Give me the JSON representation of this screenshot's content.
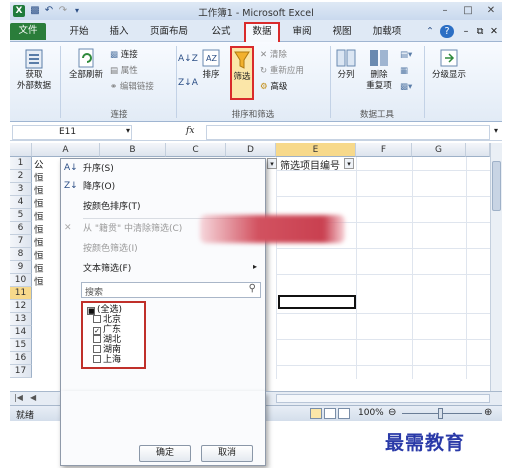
{
  "window": {
    "title": "工作簿1 - Microsoft Excel",
    "qa_icons": [
      "excel-icon",
      "save-icon",
      "undo-icon",
      "redo-icon"
    ]
  },
  "tabs": [
    {
      "label": "文件",
      "name": "tab-file"
    },
    {
      "label": "开始",
      "name": "tab-home"
    },
    {
      "label": "插入",
      "name": "tab-insert"
    },
    {
      "label": "页面布局",
      "name": "tab-page-layout"
    },
    {
      "label": "公式",
      "name": "tab-formulas"
    },
    {
      "label": "数据",
      "name": "tab-data"
    },
    {
      "label": "审阅",
      "name": "tab-review"
    },
    {
      "label": "视图",
      "name": "tab-view"
    },
    {
      "label": "加载项",
      "name": "tab-addins"
    }
  ],
  "ribbon": {
    "get_external_1": "获取",
    "get_external_2": "外部数据",
    "refresh_all": "全部刷新",
    "connections": "连接",
    "properties": "属性",
    "edit_links": "编辑链接",
    "group_connections": "连接",
    "sort": "排序",
    "filter": "筛选",
    "clear": "清除",
    "reapply": "重新应用",
    "advanced": "高级",
    "group_sort_filter": "排序和筛选",
    "text_to_columns": "分列",
    "remove_dup_1": "删除",
    "remove_dup_2": "重复项",
    "group_data_tools": "数据工具",
    "outline": "分级显示"
  },
  "formula_bar": {
    "name_box": "E11",
    "fx": "fx",
    "value": ""
  },
  "columns": [
    "A",
    "B",
    "C",
    "D",
    "E",
    "F",
    "G"
  ],
  "rows": [
    "1",
    "2",
    "3",
    "4",
    "5",
    "6",
    "7",
    "8",
    "9",
    "10",
    "11",
    "12",
    "13",
    "14",
    "15",
    "16",
    "17"
  ],
  "cells": {
    "A1": "公",
    "A2": "恒",
    "A3": "恒",
    "A4": "恒",
    "A5": "恒",
    "A6": "恒",
    "A7": "恒",
    "A8": "恒",
    "A9": "恒",
    "A10": "恒",
    "E1": "筛选项目编号"
  },
  "filter_menu": {
    "sort_asc": "升序(S)",
    "sort_desc": "降序(O)",
    "sort_by_color": "按颜色排序(T)",
    "clear_filter": "从 \"籍贯\" 中清除筛选(C)",
    "filter_by_color": "按颜色筛选(I)",
    "text_filters": "文本筛选(F)",
    "search_placeholder": "搜索",
    "items": [
      {
        "label": "(全选)",
        "state": "partial"
      },
      {
        "label": "北京",
        "state": "unchecked"
      },
      {
        "label": "广东",
        "state": "checked"
      },
      {
        "label": "湖北",
        "state": "unchecked"
      },
      {
        "label": "湖南",
        "state": "unchecked"
      },
      {
        "label": "上海",
        "state": "unchecked"
      }
    ],
    "ok": "确定",
    "cancel": "取消"
  },
  "status": {
    "ready": "就绪",
    "zoom": "100%"
  },
  "watermark": "最需教育",
  "colors": {
    "accent": "#1f7a3c",
    "highlight": "#d92b2b",
    "tab_bg": "#dfe9f5"
  }
}
